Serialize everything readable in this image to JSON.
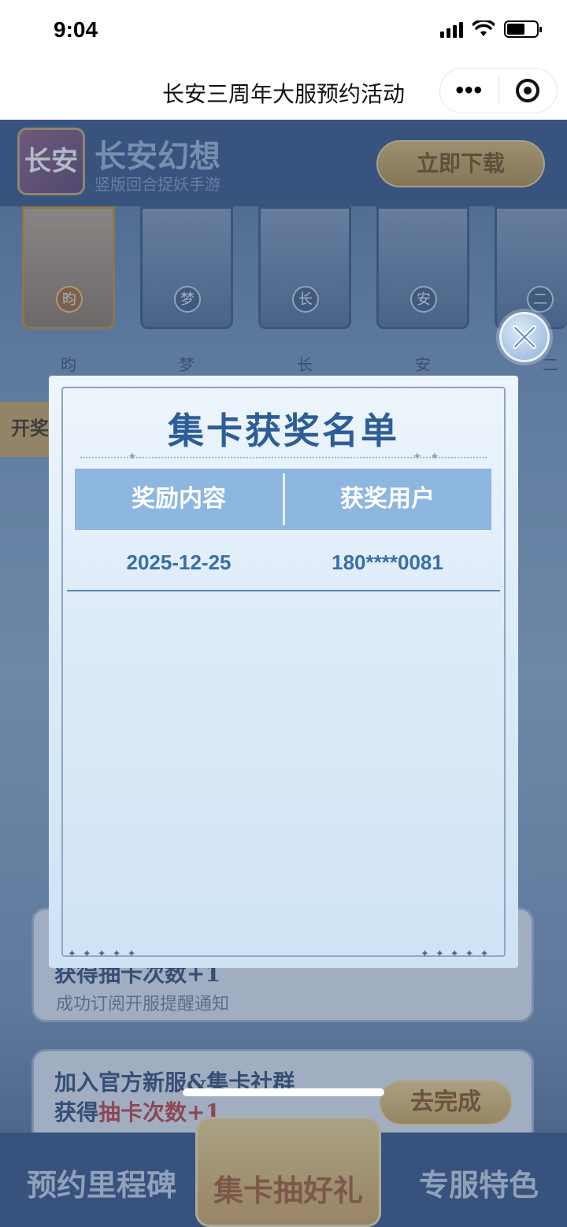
{
  "status_bar": {
    "time": "9:04",
    "battery_level": 0.6
  },
  "nav": {
    "title": "长安三周年大服预约活动",
    "more_icon": "more-dots-icon",
    "close_icon": "target-circle-icon"
  },
  "game_banner": {
    "logo_text": "长安",
    "name": "长安幻想",
    "slogan": "竖版回合捉妖手游",
    "download_label": "立即下载"
  },
  "cards": [
    {
      "seal": "昀",
      "label": "昀"
    },
    {
      "seal": "梦",
      "label": "梦"
    },
    {
      "seal": "长",
      "label": "长"
    },
    {
      "seal": "安",
      "label": "安"
    },
    {
      "seal": "二",
      "label": "二"
    }
  ],
  "side_tab": "开奖",
  "tasks": [
    {
      "main": "获得抽卡次数+1",
      "sub": "成功订阅开服提醒通知"
    },
    {
      "main_prefix": "加入官方新服&集卡社群",
      "main_line2_prefix": "获得",
      "main_line2_highlight": "抽卡次数+1",
      "button": "去完成"
    }
  ],
  "bottom_nav": {
    "left": "预约里程碑",
    "center": "集卡抽好礼",
    "right": "专服特色"
  },
  "modal": {
    "title": "集卡获奖名单",
    "columns": [
      "奖励内容",
      "获奖用户"
    ],
    "rows": [
      {
        "reward": "2025-12-25",
        "user": "180****0081"
      }
    ],
    "close_icon": "close-x-icon"
  },
  "colors": {
    "modal_title": "#2e5e97",
    "table_header": "#8db6e0",
    "table_text": "#3a6ea8",
    "highlight": "#c13b3b"
  }
}
